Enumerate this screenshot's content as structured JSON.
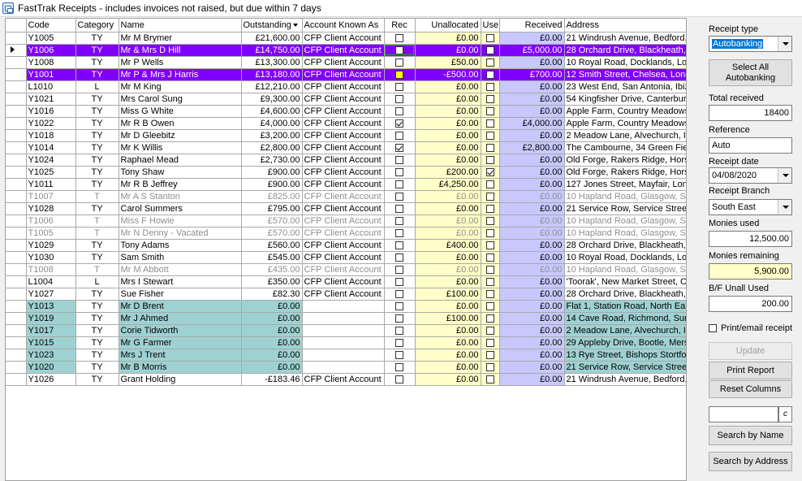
{
  "window": {
    "title": "FastTrak Receipts - includes invoices not raised, but due within 7 days"
  },
  "columns": {
    "code": "Code",
    "category": "Category",
    "name": "Name",
    "outstanding": "Outstanding",
    "account": "Account Known As",
    "rec": "Rec",
    "unallocated": "Unallocated",
    "use": "Use",
    "received": "Received",
    "address": "Address"
  },
  "rows": [
    {
      "code": "Y1005",
      "category": "TY",
      "name": "Mr M Brymer",
      "outstanding": "£21,600.00",
      "account": "CFP Client Account",
      "rec": false,
      "unallocated": "£0.00",
      "use": false,
      "received": "£0.00",
      "address": "21 Windrush Avenue, Bedford,",
      "style": "normal"
    },
    {
      "code": "Y1006",
      "category": "TY",
      "name": "Mr & Mrs D Hill",
      "outstanding": "£14,750.00",
      "account": "CFP Client Account",
      "rec": false,
      "unallocated": "£0.00",
      "use": false,
      "received": "£5,000.00",
      "address": "28 Orchard Drive, Blackheath,",
      "style": "sel",
      "current": true
    },
    {
      "code": "Y1008",
      "category": "TY",
      "name": "Mr P Wells",
      "outstanding": "£13,300.00",
      "account": "CFP Client Account",
      "rec": false,
      "unallocated": "£50.00",
      "use": false,
      "received": "£0.00",
      "address": "10 Royal Road, Docklands, Lo",
      "style": "normal"
    },
    {
      "code": "Y1001",
      "category": "TY",
      "name": "Mr P & Mrs J Harris",
      "outstanding": "£13,180.00",
      "account": "CFP Client Account",
      "rec": "yellow",
      "unallocated": "-£500.00",
      "use": false,
      "received": "£700.00",
      "address": "12 Smith Street, Chelsea, Lonc",
      "style": "sel"
    },
    {
      "code": "L1010",
      "category": "L",
      "name": "Mr M King",
      "outstanding": "£12,210.00",
      "account": "CFP Client Account",
      "rec": false,
      "unallocated": "£0.00",
      "use": false,
      "received": "£0.00",
      "address": "23 West End, San Antonia, Ibiz",
      "style": "normal"
    },
    {
      "code": "Y1021",
      "category": "TY",
      "name": "Mrs Carol Sung",
      "outstanding": "£9,300.00",
      "account": "CFP Client Account",
      "rec": false,
      "unallocated": "£0.00",
      "use": false,
      "received": "£0.00",
      "address": "54 Kingfisher Drive, Canterbury",
      "style": "normal"
    },
    {
      "code": "Y1016",
      "category": "TY",
      "name": "Miss G White",
      "outstanding": "£4,600.00",
      "account": "CFP Client Account",
      "rec": false,
      "unallocated": "£0.00",
      "use": false,
      "received": "£0.00",
      "address": "Apple Farm, Country Meadows",
      "style": "normal"
    },
    {
      "code": "Y1022",
      "category": "TY",
      "name": "Mr R B Owen",
      "outstanding": "£4,000.00",
      "account": "CFP Client Account",
      "rec": true,
      "unallocated": "£0.00",
      "use": false,
      "received": "£4,000.00",
      "address": "Apple Farm, Country Meadows",
      "style": "normal"
    },
    {
      "code": "Y1018",
      "category": "TY",
      "name": "Mr D Gleebitz",
      "outstanding": "£3,200.00",
      "account": "CFP Client Account",
      "rec": false,
      "unallocated": "£0.00",
      "use": false,
      "received": "£0.00",
      "address": "2 Meadow Lane, Alvechurch, I",
      "style": "normal"
    },
    {
      "code": "Y1014",
      "category": "TY",
      "name": "Mr K Willis",
      "outstanding": "£2,800.00",
      "account": "CFP Client Account",
      "rec": true,
      "unallocated": "£0.00",
      "use": false,
      "received": "£2,800.00",
      "address": "The Cambourne, 34 Green Fiel",
      "style": "normal"
    },
    {
      "code": "Y1024",
      "category": "TY",
      "name": "Raphael Mead",
      "outstanding": "£2,730.00",
      "account": "CFP Client Account",
      "rec": false,
      "unallocated": "£0.00",
      "use": false,
      "received": "£0.00",
      "address": "Old Forge, Rakers Ridge, Hors",
      "style": "normal"
    },
    {
      "code": "Y1025",
      "category": "TY",
      "name": "Tony Shaw",
      "outstanding": "£900.00",
      "account": "CFP Client Account",
      "rec": false,
      "unallocated": "£200.00",
      "use": true,
      "received": "£0.00",
      "address": "Old Forge, Rakers Ridge, Hors",
      "style": "normal"
    },
    {
      "code": "Y1011",
      "category": "TY",
      "name": "Mr R B Jeffrey",
      "outstanding": "£900.00",
      "account": "CFP Client Account",
      "rec": false,
      "unallocated": "£4,250.00",
      "use": false,
      "received": "£0.00",
      "address": "127 Jones Street, Mayfair, Lon",
      "style": "normal"
    },
    {
      "code": "T1007",
      "category": "T",
      "name": "Mr A S Stanton",
      "outstanding": "£825.00",
      "account": "CFP Client Account",
      "rec": false,
      "unallocated": "£0.00",
      "use": false,
      "received": "£0.00",
      "address": "10 Hapland Road, Glasgow, S",
      "style": "grey"
    },
    {
      "code": "Y1028",
      "category": "TY",
      "name": "Carol Summers",
      "outstanding": "£795.00",
      "account": "CFP Client Account",
      "rec": false,
      "unallocated": "£0.00",
      "use": false,
      "received": "£0.00",
      "address": "21 Service Row, Service Stree",
      "style": "normal"
    },
    {
      "code": "T1006",
      "category": "T",
      "name": "Miss F Howie",
      "outstanding": "£570.00",
      "account": "CFP Client Account",
      "rec": false,
      "unallocated": "£0.00",
      "use": false,
      "received": "£0.00",
      "address": "10 Hapland Road, Glasgow, S",
      "style": "grey"
    },
    {
      "code": "T1005",
      "category": "T",
      "name": "Mr N Denny - Vacated",
      "outstanding": "£570.00",
      "account": "CFP Client Account",
      "rec": false,
      "unallocated": "£0.00",
      "use": false,
      "received": "£0.00",
      "address": "10 Hapland Road, Glasgow, S",
      "style": "grey"
    },
    {
      "code": "Y1029",
      "category": "TY",
      "name": "Tony Adams",
      "outstanding": "£560.00",
      "account": "CFP Client Account",
      "rec": false,
      "unallocated": "£400.00",
      "use": false,
      "received": "£0.00",
      "address": "28 Orchard Drive, Blackheath,",
      "style": "normal"
    },
    {
      "code": "Y1030",
      "category": "TY",
      "name": "Sam Smith",
      "outstanding": "£545.00",
      "account": "CFP Client Account",
      "rec": false,
      "unallocated": "£0.00",
      "use": false,
      "received": "£0.00",
      "address": "10 Royal Road, Docklands, Lo",
      "style": "normal"
    },
    {
      "code": "T1008",
      "category": "T",
      "name": "Mr M Abbott",
      "outstanding": "£435.00",
      "account": "CFP Client Account",
      "rec": false,
      "unallocated": "£0.00",
      "use": false,
      "received": "£0.00",
      "address": "10 Hapland Road, Glasgow, S",
      "style": "grey"
    },
    {
      "code": "L1004",
      "category": "L",
      "name": "Mrs I Stewart",
      "outstanding": "£350.00",
      "account": "CFP Client Account",
      "rec": false,
      "unallocated": "£0.00",
      "use": false,
      "received": "£0.00",
      "address": "'Toorak', New Market Street, C",
      "style": "normal"
    },
    {
      "code": "Y1027",
      "category": "TY",
      "name": "Sue Fisher",
      "outstanding": "£82.30",
      "account": "CFP Client Account",
      "rec": false,
      "unallocated": "£100.00",
      "use": false,
      "received": "£0.00",
      "address": "28 Orchard Drive, Blackheath,",
      "style": "normal"
    },
    {
      "code": "Y1013",
      "category": "TY",
      "name": "Mr D Brent",
      "outstanding": "£0.00",
      "account": "",
      "rec": false,
      "unallocated": "£0.00",
      "use": false,
      "received": "£0.00",
      "address": "Flat 1, Station Road, North Eal",
      "style": "teal"
    },
    {
      "code": "Y1019",
      "category": "TY",
      "name": "Mr J Ahmed",
      "outstanding": "£0.00",
      "account": "",
      "rec": false,
      "unallocated": "£100.00",
      "use": false,
      "received": "£0.00",
      "address": "14 Cave Road, Richmond, Sur",
      "style": "teal"
    },
    {
      "code": "Y1017",
      "category": "TY",
      "name": "Corie Tidworth",
      "outstanding": "£0.00",
      "account": "",
      "rec": false,
      "unallocated": "£0.00",
      "use": false,
      "received": "£0.00",
      "address": "2 Meadow Lane, Alvechurch, I",
      "style": "teal"
    },
    {
      "code": "Y1015",
      "category": "TY",
      "name": "Mr G Farmer",
      "outstanding": "£0.00",
      "account": "",
      "rec": false,
      "unallocated": "£0.00",
      "use": false,
      "received": "£0.00",
      "address": "29 Appleby Drive, Bootle, Mers",
      "style": "teal"
    },
    {
      "code": "Y1023",
      "category": "TY",
      "name": "Mrs J Trent",
      "outstanding": "£0.00",
      "account": "",
      "rec": false,
      "unallocated": "£0.00",
      "use": false,
      "received": "£0.00",
      "address": "13 Rye Street, Bishops Stortfor",
      "style": "teal"
    },
    {
      "code": "Y1020",
      "category": "TY",
      "name": "Mr B Morris",
      "outstanding": "£0.00",
      "account": "",
      "rec": false,
      "unallocated": "£0.00",
      "use": false,
      "received": "£0.00",
      "address": "21 Service Row, Service Stree",
      "style": "teal"
    },
    {
      "code": "Y1026",
      "category": "TY",
      "name": "Grant Holding",
      "outstanding": "-£183.46",
      "account": "CFP Client Account",
      "rec": false,
      "unallocated": "£0.00",
      "use": false,
      "received": "£0.00",
      "address": "21 Windrush Avenue, Bedford,",
      "style": "normal"
    }
  ],
  "panel": {
    "receipt_type_label": "Receipt type",
    "receipt_type_value": "Autobanking",
    "select_all_label": "Select All\nAutobanking",
    "total_received_label": "Total received",
    "total_received_value": "18400",
    "reference_label": "Reference",
    "reference_value": "Auto",
    "receipt_date_label": "Receipt date",
    "receipt_date_value": "04/08/2020",
    "receipt_branch_label": "Receipt Branch",
    "receipt_branch_value": "South East",
    "monies_used_label": "Monies used",
    "monies_used_value": "12,500.00",
    "monies_remaining_label": "Monies remaining",
    "monies_remaining_value": "5,900.00",
    "bf_unall_label": "B/F Unall Used",
    "bf_unall_value": "200.00",
    "print_email_label": "Print/email receipt",
    "update_label": "Update",
    "print_report_label": "Print Report",
    "reset_columns_label": "Reset Columns",
    "search_clear_glyph": "c",
    "search_name_label": "Search by Name",
    "search_address_label": "Search by Address"
  },
  "colors": {
    "selected_row": "#8000ff",
    "unallocated_bg": "#fffec8",
    "received_bg": "#c8c8ff",
    "teal_row": "#9ed2d2",
    "monies_remaining_bg": "#ffffc8"
  }
}
